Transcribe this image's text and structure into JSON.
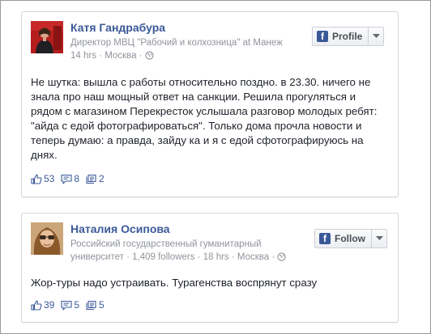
{
  "posts": [
    {
      "author": "Катя Гандрабура",
      "subtitle": "Директор МВЦ \"Рабочий и колхозница\"",
      "at_word": " at ",
      "place": "Манеж",
      "time": "14 hrs",
      "location": "Москва",
      "separator": " · ",
      "button_label": "Profile",
      "text": "Не шутка: вышла с работы относительно поздно. в 23.30. ничего не знала про наш мощный ответ на санкции. Решила прогуляться и рядом с магазином Перекресток услышала разговор молодых ребят: \"айда с едой фотографироваться\". Только дома прочла новости и теперь думаю: а правда, зайду ка и я с едой сфотографируюсь на днях.",
      "likes": "53",
      "comments": "8",
      "shares": "2"
    },
    {
      "author": "Наталия Осипова",
      "subtitle_line1": "Российский государственный гуманитарный",
      "subtitle_line2": "университет",
      "followers": "1,409 followers",
      "time": "18 hrs",
      "location": "Москва",
      "separator": " · ",
      "button_label": "Follow",
      "text": "Жор-туры надо устраивать. Турагенства воспрянут сразу",
      "likes": "39",
      "comments": "5",
      "shares": "5"
    }
  ],
  "colors": {
    "link": "#3b5998",
    "meta": "#90949c",
    "text": "#1d2129"
  }
}
